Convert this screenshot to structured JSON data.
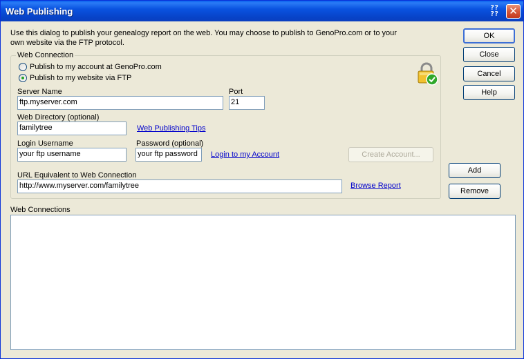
{
  "window": {
    "title": "Web Publishing",
    "help_glyph": "?",
    "close_glyph": "✕"
  },
  "intro_text": "Use this dialog to publish your genealogy report on the web.  You may choose to publish to GenoPro.com or to your own website via the FTP protocol.",
  "web_connection": {
    "legend": "Web Connection",
    "radio_genopro_label": "Publish to my account at GenoPro.com",
    "radio_ftp_label": "Publish to my website via FTP",
    "selected": "ftp",
    "server_name_label": "Server Name",
    "server_name_value": "ftp.myserver.com",
    "port_label": "Port",
    "port_value": "21",
    "web_directory_label": "Web Directory  (optional)",
    "web_directory_value": "familytree",
    "tips_link": "Web Publishing Tips",
    "login_username_label": "Login Username",
    "login_username_value": "your ftp username",
    "password_label": "Password  (optional)",
    "password_value": "your ftp password",
    "login_account_link": "Login to my Account",
    "create_account_button": "Create Account...",
    "url_label": "URL Equivalent to Web Connection",
    "url_value": "http://www.myserver.com/familytree",
    "browse_report_link": "Browse Report"
  },
  "buttons": {
    "ok": "OK",
    "close": "Close",
    "cancel": "Cancel",
    "help": "Help",
    "add": "Add",
    "remove": "Remove"
  },
  "web_connections_label": "Web Connections",
  "web_connections_items": [],
  "icons": {
    "lock": "lock-check-icon"
  }
}
